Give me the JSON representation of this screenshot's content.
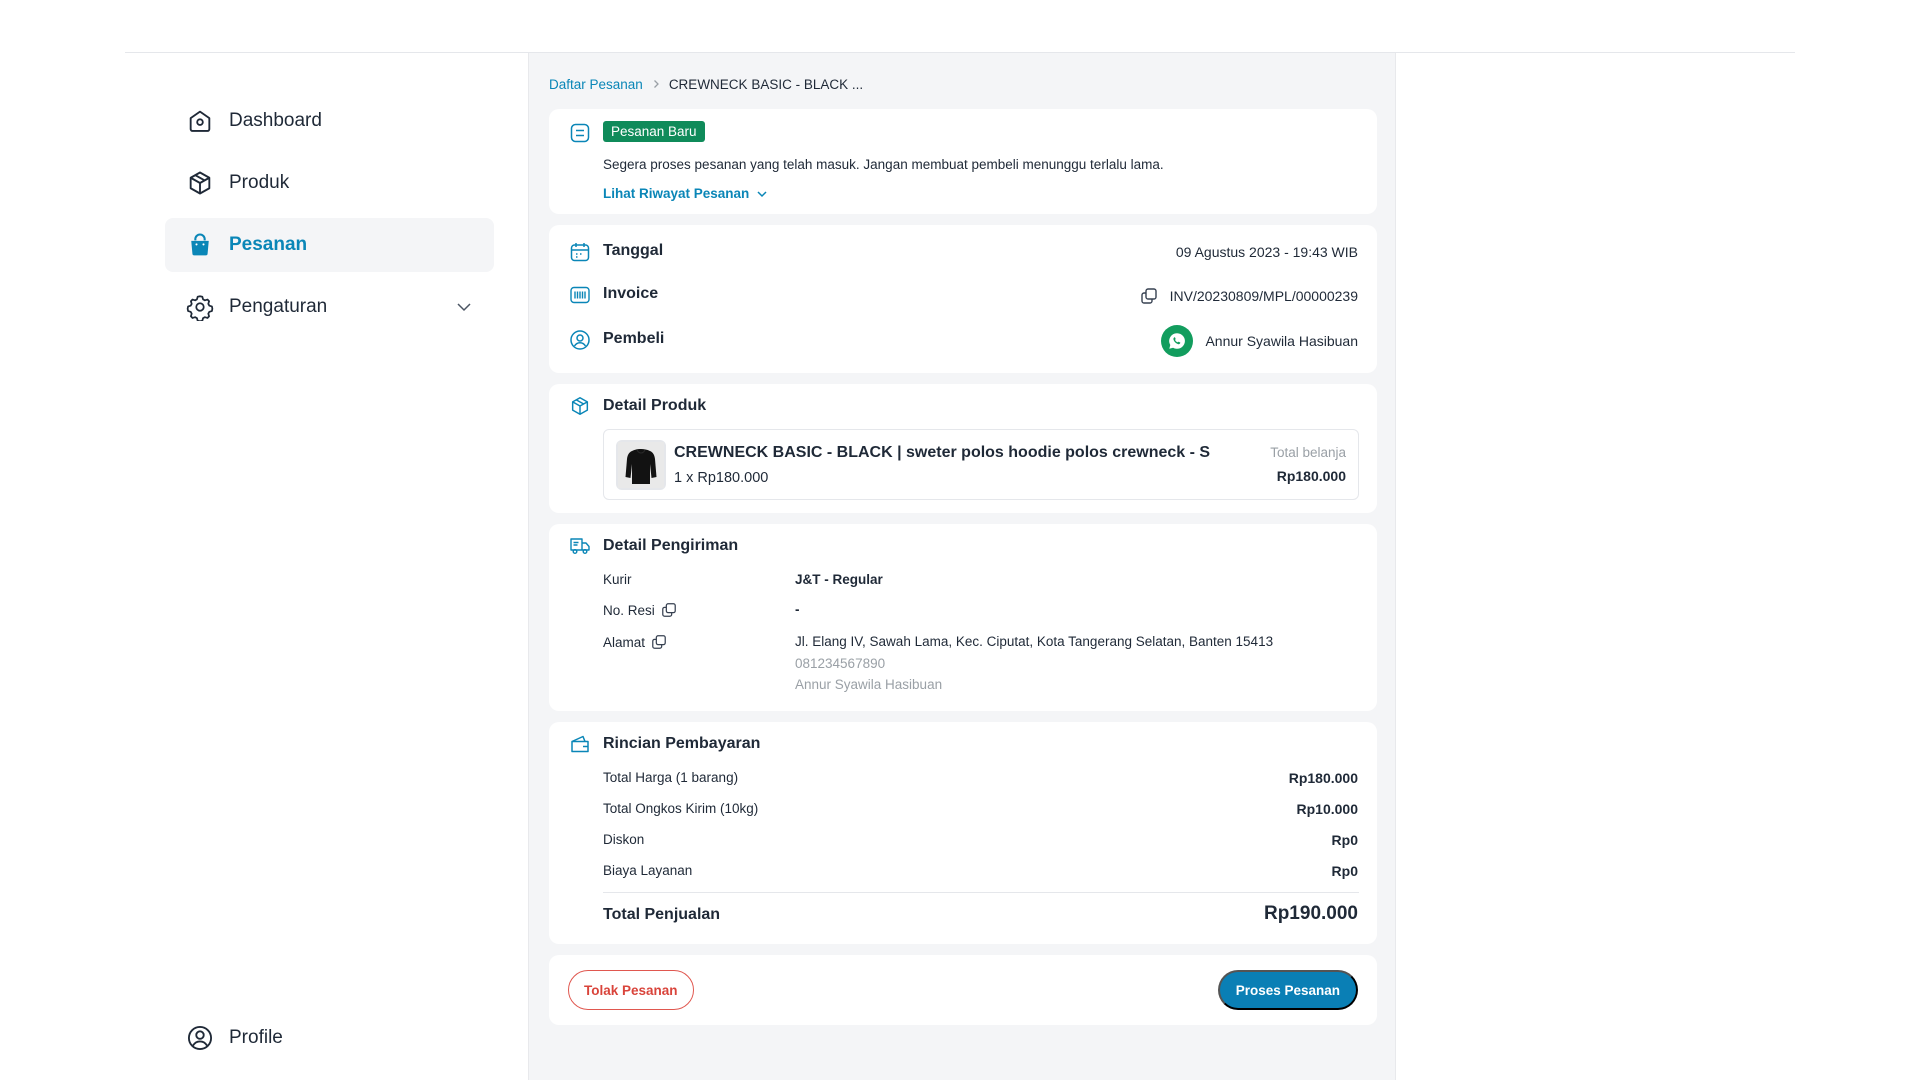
{
  "colors": {
    "accent": "#0a86b7",
    "success": "#0f8b5a",
    "danger": "#d9443b",
    "whatsapp": "#129d5e"
  },
  "sidebar": {
    "items": [
      {
        "label": "Dashboard",
        "icon": "home-icon"
      },
      {
        "label": "Produk",
        "icon": "box-icon"
      },
      {
        "label": "Pesanan",
        "icon": "shopping-bag-icon",
        "active": true
      },
      {
        "label": "Pengaturan",
        "icon": "gear-icon"
      }
    ],
    "profile_label": "Profile"
  },
  "breadcrumb": {
    "parent": "Daftar Pesanan",
    "current": "CREWNECK BASIC - BLACK ..."
  },
  "status": {
    "badge": "Pesanan Baru",
    "description": "Segera proses pesanan yang telah masuk. Jangan membuat pembeli menunggu terlalu lama.",
    "history_link": "Lihat Riwayat Pesanan"
  },
  "order_info": {
    "date_label": "Tanggal",
    "date_value": "09 Agustus 2023 - 19:43 WIB",
    "invoice_label": "Invoice",
    "invoice_value": "INV/20230809/MPL/00000239",
    "buyer_label": "Pembeli",
    "buyer_value": "Annur Syawila Hasibuan"
  },
  "product": {
    "title": "Detail Produk",
    "name": "CREWNECK BASIC - BLACK | sweter polos hoodie polos crewneck - S",
    "qty_price": "1 x Rp180.000",
    "total_label": "Total belanja",
    "total_value": "Rp180.000"
  },
  "shipping": {
    "title": "Detail Pengiriman",
    "courier_label": "Kurir",
    "courier_value": "J&T - Regular",
    "resi_label": "No. Resi",
    "resi_value": "-",
    "address_label": "Alamat",
    "address_value": "Jl. Elang IV, Sawah Lama, Kec. Ciputat, Kota Tangerang Selatan, Banten 15413",
    "phone": "081234567890",
    "recipient": "Annur Syawila Hasibuan"
  },
  "payment": {
    "title": "Rincian Pembayaran",
    "rows": [
      {
        "label": "Total Harga (1 barang)",
        "value": "Rp180.000"
      },
      {
        "label": "Total Ongkos Kirim (10kg)",
        "value": "Rp10.000"
      },
      {
        "label": "Diskon",
        "value": "Rp0"
      },
      {
        "label": "Biaya Layanan",
        "value": "Rp0"
      }
    ],
    "total_label": "Total Penjualan",
    "total_value": "Rp190.000"
  },
  "actions": {
    "reject": "Tolak Pesanan",
    "process": "Proses Pesanan"
  }
}
